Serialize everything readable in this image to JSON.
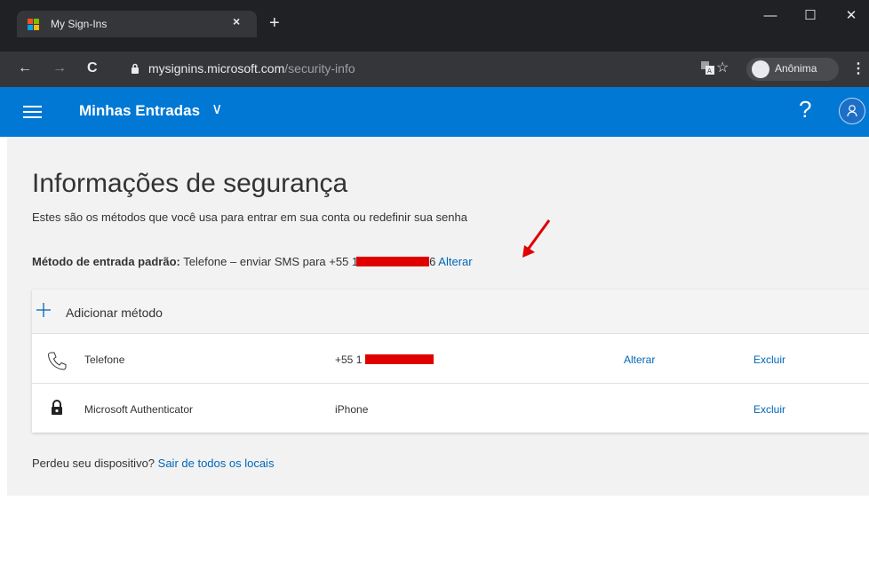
{
  "browser": {
    "tab_title": "My Sign-Ins",
    "close_tab": "×",
    "new_tab": "+",
    "url_host": "mysignins.microsoft.com",
    "url_path": "/security-info",
    "incognito_label": "Anônima",
    "window_minimize": "—",
    "window_maximize": "☐",
    "window_close": "✕",
    "back": "←",
    "forward": "→",
    "reload": "C",
    "star": "☆",
    "menu": "⋮",
    "favicon_colors": [
      "#f25022",
      "#7fba00",
      "#00a4ef",
      "#ffb900"
    ]
  },
  "header": {
    "title": "Minhas Entradas",
    "chevron": "∨",
    "help": "?",
    "accent": "#0078d4"
  },
  "main": {
    "page_title": "Informações de segurança",
    "description": "Estes são os métodos que você usa para entrar em sua conta ou redefinir sua senha",
    "default_label": "Método de entrada padrão:",
    "default_value": " Telefone – enviar SMS para +55 1",
    "default_suffix": "6 ",
    "default_change": "Alterar",
    "add_method": "Adicionar método",
    "methods": [
      {
        "icon": "phone-icon",
        "name": "Telefone",
        "value": "+55 1",
        "change": "Alterar",
        "delete": "Excluir"
      },
      {
        "icon": "authenticator-lock-icon",
        "name": "Microsoft Authenticator",
        "value": "iPhone",
        "change": "",
        "delete": "Excluir"
      }
    ],
    "lost_device": "Perdeu seu dispositivo? ",
    "sign_out_all": "Sair de todos os locais"
  }
}
